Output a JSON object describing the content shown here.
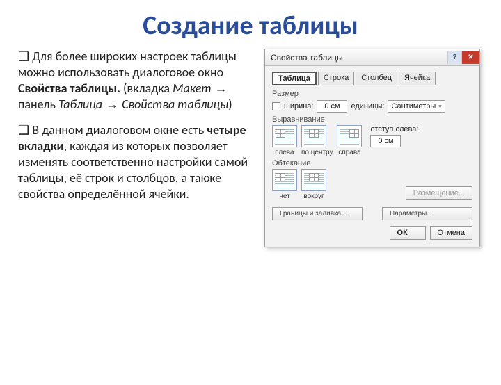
{
  "title": "Создание таблицы",
  "para1": {
    "prefix": "❑ Для более широких настроек таблицы можно использовать диалоговое окно ",
    "bold1": "Свойства таблицы.",
    "mid1": " (вкладка ",
    "i1": "Макет",
    "arrow": " → ",
    "mid2": "панель ",
    "i2": "Таблица",
    "arrow2": " → ",
    "i3": "Свойства таблицы",
    "end": ")"
  },
  "para2": {
    "prefix": "❑  В данном диалоговом окне есть ",
    "bold": "четыре вкладки",
    "rest": ", каждая из которых позволяет изменять соответственно настройки самой таблицы, её строк и столбцов, а также свойства определённой ячейки."
  },
  "dialog": {
    "title": "Свойства таблицы",
    "tabs": [
      "Таблица",
      "Строка",
      "Столбец",
      "Ячейка"
    ],
    "sizeLabel": "Размер",
    "widthCheck": "ширина:",
    "widthVal": "0 см",
    "unitsLabel": "единицы:",
    "unitsVal": "Сантиметры",
    "alignLabel": "Выравнивание",
    "alignOptions": [
      "слева",
      "по центру",
      "справа"
    ],
    "indentLabel": "отступ слева:",
    "indentVal": "0 см",
    "wrapLabel": "Обтекание",
    "wrapOptions": [
      "нет",
      "вокруг"
    ],
    "posBtn": "Размещение...",
    "bordersBtn": "Границы и заливка...",
    "paramsBtn": "Параметры...",
    "okBtn": "ОК",
    "cancelBtn": "Отмена"
  }
}
